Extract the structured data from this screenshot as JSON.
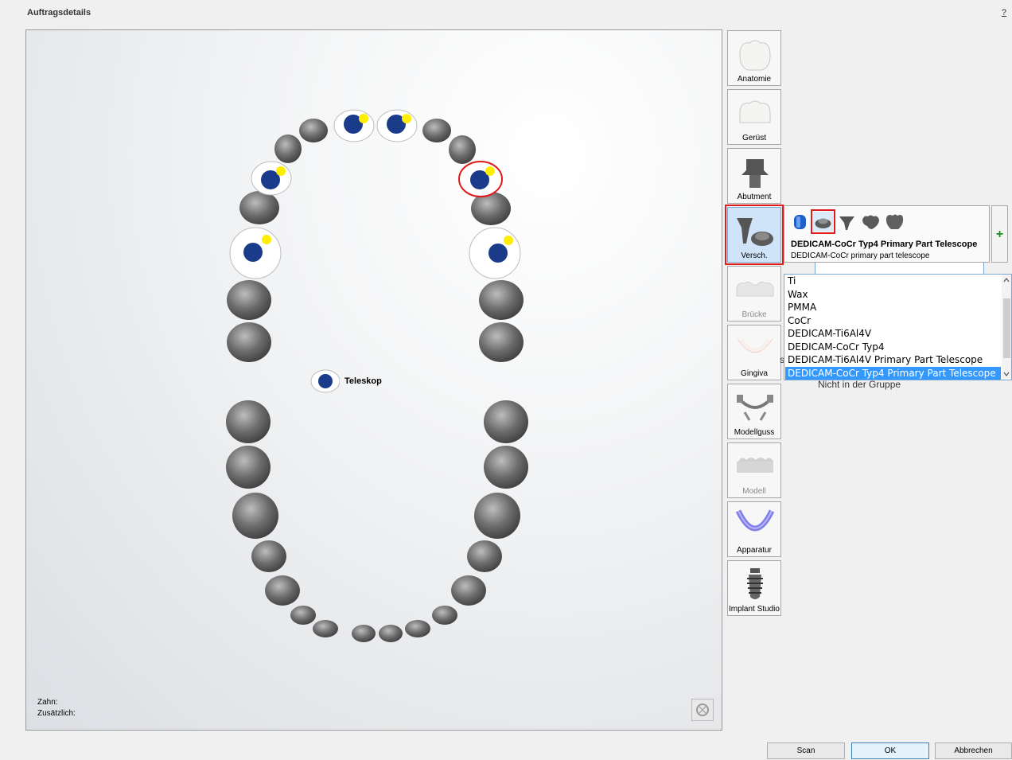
{
  "window": {
    "title": "Auftragsdetails",
    "help_label": "?"
  },
  "canvas": {
    "tooth_label": "Zahn:",
    "extra_label": "Zusätzlich:",
    "legend_label": "Teleskop"
  },
  "toolbar": {
    "items": [
      {
        "label": "Anatomie",
        "state": "normal"
      },
      {
        "label": "Gerüst",
        "state": "normal"
      },
      {
        "label": "Abutment",
        "state": "normal"
      },
      {
        "label": "Versch.",
        "state": "active"
      },
      {
        "label": "Brücke",
        "state": "disabled"
      },
      {
        "label": "Gingiva",
        "state": "normal"
      },
      {
        "label": "Modellguss",
        "state": "normal"
      },
      {
        "label": "Modell",
        "state": "disabled"
      },
      {
        "label": "Apparatur",
        "state": "normal"
      },
      {
        "label": "Implant Studio",
        "state": "normal"
      }
    ]
  },
  "material_panel": {
    "title": "DEDICAM-CoCr Typ4 Primary Part Telescope",
    "subtitle": "DEDICAM-CoCr primary part telescope",
    "add_label": "+",
    "icons": [
      "coping-icon",
      "telescope-icon",
      "post-icon",
      "pontic-icon",
      "crown-icon"
    ]
  },
  "dropdown": {
    "options": [
      "Ti",
      "Wax",
      "PMMA",
      "CoCr",
      "DEDICAM-Ti6Al4V",
      "DEDICAM-CoCr Typ4",
      "DEDICAM-Ti6Al4V Primary Part Telescope",
      "DEDICAM-CoCr Typ4 Primary Part Telescope"
    ],
    "selected": "DEDICAM-CoCr Typ4 Primary Part Telescope"
  },
  "behind": {
    "group_text": "Nicht in der Gruppe",
    "partial": "s"
  },
  "buttons": {
    "scan": "Scan",
    "ok": "OK",
    "cancel": "Abbrechen"
  },
  "colors": {
    "telescope_marker": "#1a3a8a",
    "marker_dot": "#ffee00",
    "highlight": "#e01b1b",
    "selection": "#3399ff"
  }
}
